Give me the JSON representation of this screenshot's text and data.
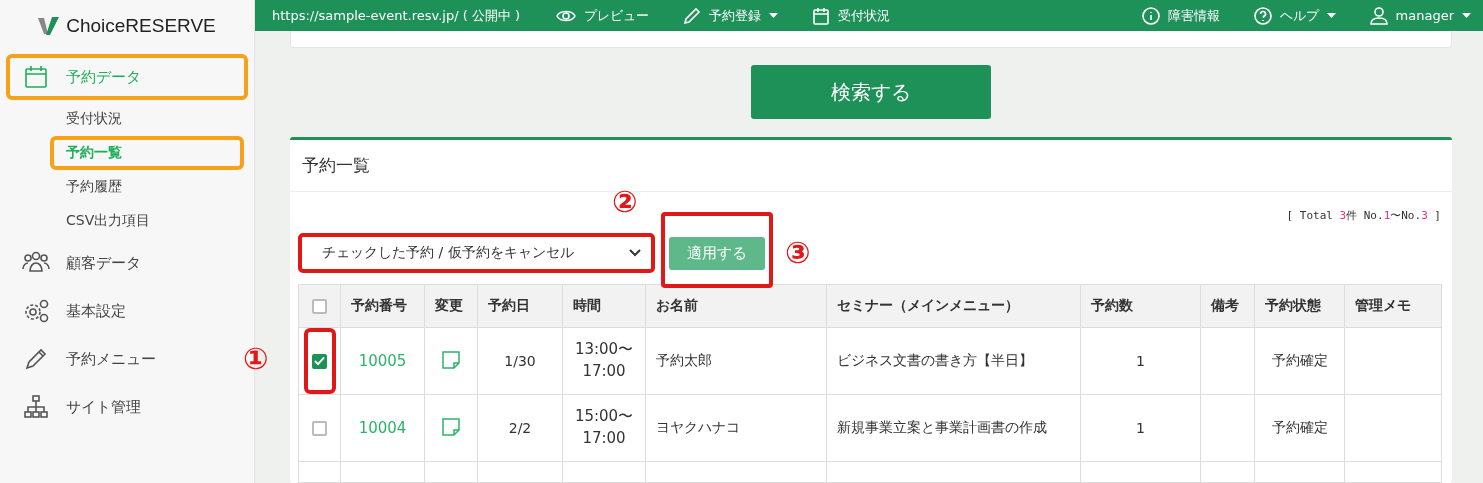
{
  "logo": {
    "text": "ChoiceRESERVE"
  },
  "sidebar": {
    "items": [
      {
        "label": "予約データ",
        "selected": true,
        "highlighted": true,
        "children": [
          {
            "label": "受付状況",
            "selected": false,
            "highlighted": false
          },
          {
            "label": "予約一覧",
            "selected": true,
            "highlighted": true
          },
          {
            "label": "予約履歴",
            "selected": false,
            "highlighted": false
          },
          {
            "label": "CSV出力項目",
            "selected": false,
            "highlighted": false
          }
        ]
      },
      {
        "label": "顧客データ",
        "selected": false,
        "highlighted": false
      },
      {
        "label": "基本設定",
        "selected": false,
        "highlighted": false
      },
      {
        "label": "予約メニュー",
        "selected": false,
        "highlighted": false
      },
      {
        "label": "サイト管理",
        "selected": false,
        "highlighted": false
      }
    ]
  },
  "topbar": {
    "url": "https://sample-event.resv.jp/ ( 公開中 )",
    "left": [
      {
        "label": "プレビュー",
        "dropdown": false
      },
      {
        "label": "予約登録",
        "dropdown": true
      },
      {
        "label": "受付状況",
        "dropdown": false
      }
    ],
    "right": [
      {
        "label": "障害情報",
        "dropdown": false
      },
      {
        "label": "ヘルプ",
        "dropdown": true
      },
      {
        "label": "manager",
        "dropdown": true
      }
    ]
  },
  "search_button": "検索する",
  "list": {
    "title": "予約一覧",
    "total": {
      "prefix": "[ Total ",
      "count": "3",
      "unit": "件 No.",
      "from": "1",
      "mid": "〜No.",
      "to": "3",
      "suffix": " ]"
    },
    "bulk_action": {
      "value": "チェックした予約 / 仮予約をキャンセル",
      "highlighted": true,
      "marker": "②"
    },
    "apply_button": {
      "label": "適用する",
      "highlighted": true,
      "marker": "③"
    },
    "table": {
      "select_all_checked": false,
      "columns": [
        "予約番号",
        "変更",
        "予約日",
        "時間",
        "お名前",
        "セミナー（メインメニュー）",
        "予約数",
        "備考",
        "予約状態",
        "管理メモ"
      ],
      "rows": [
        {
          "checked": true,
          "highlighted": true,
          "marker": "①",
          "number": "10005",
          "date": "1/30",
          "time": [
            "13:00〜",
            "17:00"
          ],
          "name": "予約太郎",
          "seminar": "ビジネス文書の書き方【半日】",
          "count": "1",
          "status": "予約確定"
        },
        {
          "checked": false,
          "highlighted": false,
          "number": "10004",
          "date": "2/2",
          "time": [
            "15:00〜",
            "17:00"
          ],
          "name": "ヨヤクハナコ",
          "seminar": "新規事業立案と事業計画書の作成",
          "count": "1",
          "status": "予約確定"
        }
      ]
    }
  }
}
